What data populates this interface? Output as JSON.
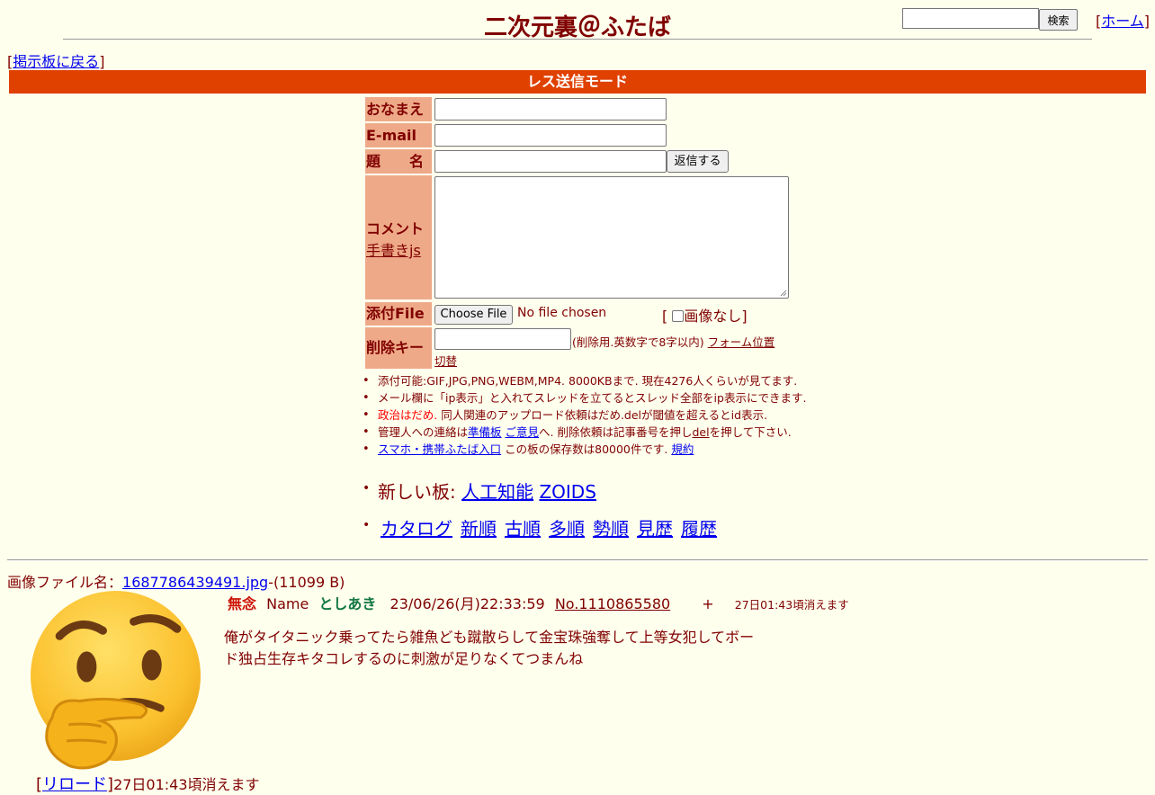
{
  "header": {
    "site_title": "二次元裏＠ふたば",
    "search_button": "検索",
    "home_bracket_open": "[",
    "home_link": "ホーム",
    "home_bracket_close": "]"
  },
  "nav": {
    "back_open": "[",
    "back_link": "掲示板に戻る",
    "back_close": "]"
  },
  "mode_bar": "レス送信モード",
  "form": {
    "name_label": "おなまえ",
    "email_label": "E-mail",
    "subject_label": "題　　名",
    "submit_button": "返信する",
    "comment_label": "コメント",
    "handwriting_link": "手書きjs",
    "file_label": "添付File",
    "choose_file_button": "Choose File",
    "no_file_text": "No file chosen",
    "no_image_open": "[",
    "no_image_label": "画像なし",
    "no_image_close": "]",
    "delkey_label": "削除キー",
    "delkey_hint": "(削除用.英数字で8字以内)",
    "form_pos_link_1": "フォーム位置",
    "form_pos_link_2": "切替"
  },
  "notes": {
    "n1": "添付可能:GIF,JPG,PNG,WEBM,MP4. 8000KBまで. 現在4276人くらいが見てます.",
    "n2": "メール欄に「ip表示」と入れてスレッドを立てるとスレッド全部をip表示にできます.",
    "n3_red": "政治はだめ.",
    "n3_rest": " 同人関連のアップロード依頼はだめ.delが閾値を超えるとid表示.",
    "n4_a": "管理人への連絡は",
    "n4_link1": "準備板",
    "n4_link2": "ご意見",
    "n4_b": "へ. 削除依頼は記事番号を押し",
    "n4_del": "del",
    "n4_c": "を押して下さい.",
    "n5_link": "スマホ・携帯ふたば入口",
    "n5_mid": " この板の保存数は80000件です. ",
    "n5_rules": "規約"
  },
  "new_boards": {
    "label": "新しい板: ",
    "items": [
      "人工知能",
      "ZOIDS"
    ]
  },
  "nav_links": [
    "カタログ",
    "新順",
    "古順",
    "多順",
    "勢順",
    "見歴",
    "履歴"
  ],
  "post": {
    "image_label": "画像ファイル名：",
    "image_file": "1687786439491.jpg",
    "image_size": "-(11099 B)",
    "subject": "無念",
    "name_label": "Name",
    "name": "としあき",
    "datetime": "23/06/26(月)22:33:59",
    "number": "No.1110865580",
    "plus": "+",
    "expires": "27日01:43頃消えます",
    "body_line1": "俺がタイタニック乗ってたら雑魚ども蹴散らして金宝珠強奪して上等女犯してボー",
    "body_line2": "ド独占生存キタコレするのに刺激が足りなくてつまんね"
  },
  "footer": {
    "open": "[",
    "reload_link": "リロード",
    "close": "]",
    "expires": "27日01:43頃消えます"
  },
  "colors": {
    "background": "#ffffee",
    "text": "#800000",
    "mode_bar": "#e04000",
    "label_bg": "#eeaa88",
    "name_green": "#117743",
    "subject_red": "#cc1105"
  },
  "icons": {
    "thumbnail": "thinking-face-emoji"
  }
}
